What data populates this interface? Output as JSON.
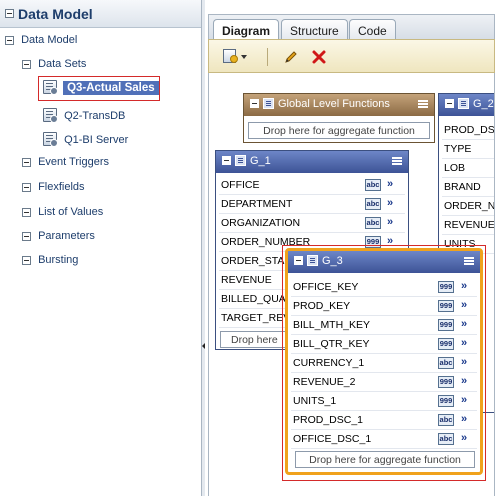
{
  "left_panel": {
    "title": "Data Model",
    "root": "Data Model",
    "data_sets": "Data Sets",
    "datasets": [
      "Q3-Actual Sales",
      "Q2-TransDB",
      "Q1-BI Server"
    ],
    "items": [
      "Event Triggers",
      "Flexfields",
      "List of Values",
      "Parameters",
      "Bursting"
    ]
  },
  "tabs": [
    "Diagram",
    "Structure",
    "Code"
  ],
  "canvas": {
    "global_level_functions": "Global Level Functions",
    "drop_aggregate": "Drop here for aggregate function",
    "drop_short": "Drop here",
    "g1": {
      "title": "G_1",
      "fields": [
        {
          "name": "OFFICE",
          "type": "abc"
        },
        {
          "name": "DEPARTMENT",
          "type": "abc"
        },
        {
          "name": "ORGANIZATION",
          "type": "abc"
        },
        {
          "name": "ORDER_NUMBER",
          "type": "999"
        },
        {
          "name": "ORDER_STA",
          "type": ""
        },
        {
          "name": "REVENUE",
          "type": ""
        },
        {
          "name": "BILLED_QUA",
          "type": ""
        },
        {
          "name": "TARGET_REV",
          "type": ""
        }
      ]
    },
    "g2": {
      "title": "G_2",
      "fields": [
        "PROD_DSC",
        "TYPE",
        "LOB",
        "BRAND",
        "ORDER_NU",
        "REVENUE_",
        "UNITS"
      ]
    },
    "g3": {
      "title": "G_3",
      "fields": [
        {
          "name": "OFFICE_KEY",
          "type": "999"
        },
        {
          "name": "PROD_KEY",
          "type": "999"
        },
        {
          "name": "BILL_MTH_KEY",
          "type": "999"
        },
        {
          "name": "BILL_QTR_KEY",
          "type": "999"
        },
        {
          "name": "CURRENCY_1",
          "type": "abc"
        },
        {
          "name": "REVENUE_2",
          "type": "999"
        },
        {
          "name": "UNITS_1",
          "type": "999"
        },
        {
          "name": "PROD_DSC_1",
          "type": "abc"
        },
        {
          "name": "OFFICE_DSC_1",
          "type": "abc"
        }
      ]
    }
  },
  "colors": {
    "highlight_border": "#d42a2a",
    "selected_bg": "#5070b8",
    "g3_border": "#f0a21c"
  }
}
